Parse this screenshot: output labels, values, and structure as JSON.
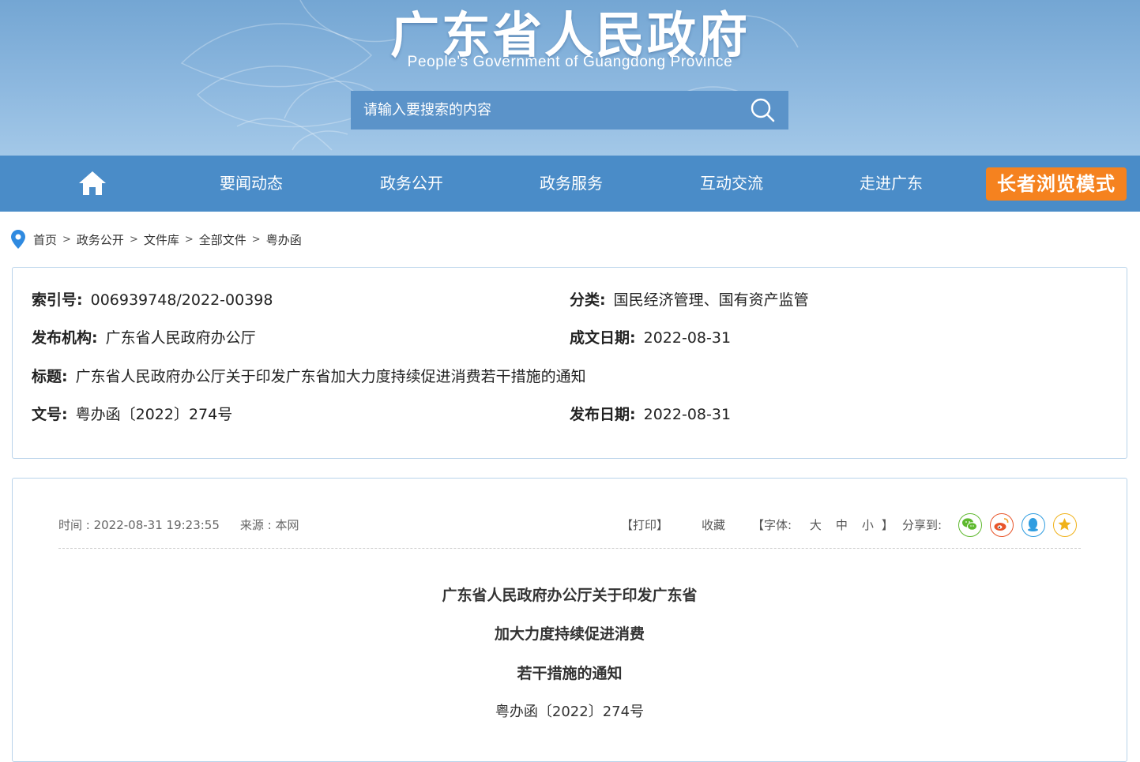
{
  "header": {
    "title": "广东省人民政府",
    "subtitle": "People's Government of Guangdong Province",
    "search_placeholder": "请输入要搜索的内容"
  },
  "nav": {
    "home_icon": "home-icon",
    "items": [
      "要闻动态",
      "政务公开",
      "政务服务",
      "互动交流",
      "走进广东"
    ],
    "elder_mode": "长者浏览模式"
  },
  "breadcrumb": [
    "首页",
    "政务公开",
    "文件库",
    "全部文件",
    "粤办函"
  ],
  "info": {
    "index_label": "索引号:",
    "index_value": "006939748/2022-00398",
    "category_label": "分类:",
    "category_value": "国民经济管理、国有资产监管",
    "publisher_label": "发布机构:",
    "publisher_value": "广东省人民政府办公厅",
    "written_date_label": "成文日期:",
    "written_date_value": "2022-08-31",
    "title_label": "标题:",
    "title_value": "广东省人民政府办公厅关于印发广东省加大力度持续促进消费若干措施的通知",
    "doc_no_label": "文号:",
    "doc_no_value": "粤办函〔2022〕274号",
    "publish_date_label": "发布日期:",
    "publish_date_value": "2022-08-31"
  },
  "article": {
    "time": "时间 : 2022-08-31 19:23:55",
    "source": "来源 : 本网",
    "print": "【打印】",
    "favorite": "收藏",
    "font_label": "【字体: ",
    "font_large": "大",
    "font_medium": "中",
    "font_small": "小",
    "font_close": "】",
    "share_label": "分享到:",
    "share_icons": [
      "wechat-icon",
      "weibo-icon",
      "qq-icon",
      "favorite-star-icon"
    ],
    "share_colors": [
      "#5fb92f",
      "#e8552a",
      "#2f9de0",
      "#f0b21a"
    ],
    "title_lines": [
      "广东省人民政府办公厅关于印发广东省",
      "加大力度持续促进消费",
      "若干措施的通知"
    ],
    "doc_number": "粤办函〔2022〕274号"
  }
}
